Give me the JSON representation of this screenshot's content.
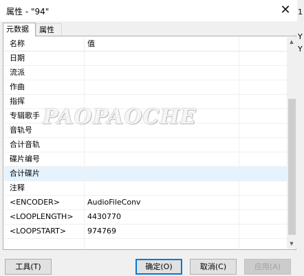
{
  "window": {
    "title": "属性 - \"94\"",
    "close_glyph": "✕"
  },
  "right_strip": {
    "chars": [
      "1",
      "Y",
      "Y"
    ]
  },
  "tabs": [
    {
      "label": "元数据"
    },
    {
      "label": "属性"
    }
  ],
  "table": {
    "columns": [
      "名称",
      "值"
    ],
    "rows": [
      {
        "name": "日期",
        "value": ""
      },
      {
        "name": "流派",
        "value": ""
      },
      {
        "name": "作曲",
        "value": ""
      },
      {
        "name": "指挥",
        "value": ""
      },
      {
        "name": "专辑歌手",
        "value": ""
      },
      {
        "name": "音轨号",
        "value": ""
      },
      {
        "name": "合计音轨",
        "value": ""
      },
      {
        "name": "碟片编号",
        "value": ""
      },
      {
        "name": "合计碟片",
        "value": ""
      },
      {
        "name": "注释",
        "value": ""
      },
      {
        "name": "<ENCODER>",
        "value": "AudioFileConv"
      },
      {
        "name": "<LOOPLENGTH>",
        "value": "4430770"
      },
      {
        "name": "<LOOPSTART>",
        "value": "974769"
      }
    ],
    "selected_row": "合计碟片"
  },
  "watermark": "PAOPAOCHE",
  "buttons": {
    "tools": "工具(T)",
    "ok": "确定(O)",
    "cancel": "取消(C)",
    "apply": "应用(A)"
  },
  "colors": {
    "selection": "#e5f3ff",
    "default_button_border": "#0078d7"
  }
}
